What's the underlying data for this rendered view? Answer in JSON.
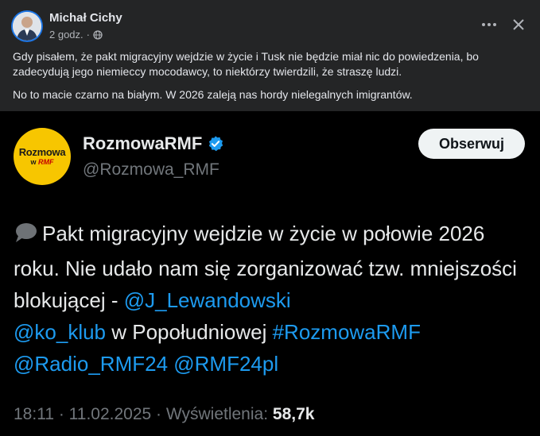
{
  "post": {
    "author": "Michał Cichy",
    "time": "2 godz.",
    "audience_icon": "globe-icon",
    "paragraph1": "Gdy pisałem, że pakt migracyjny wejdzie w życie i Tusk nie będzie miał nic do powiedzenia, bo zadecydują jego niemieccy mocodawcy, to niektórzy twierdzili, że straszę ludzi.",
    "paragraph2": "No to macie czarno na białym. W 2026 zaleją nas hordy nielegalnych imigrantów."
  },
  "tweet": {
    "avatar_line1": "Rozmowa",
    "avatar_line2a": "w",
    "avatar_line2b": "RMF",
    "display_name": "RozmowaRMF",
    "handle": "@Rozmowa_RMF",
    "follow_label": "Obserwuj",
    "text_part1": "Pakt migracyjny wejdzie w życie w połowie 2026 roku. Nie udało nam się zorganizować tzw. mniejszości blokującej - ",
    "mention1": "@J_Lewandowski",
    "mention2": "@ko_klub",
    "text_part2": " w Popołudniowej ",
    "hashtag": "#RozmowaRMF",
    "mention3": "@Radio_RMF24",
    "mention4": "@RMF24pl",
    "timestamp": "18:11 · 11.02.2025 · Wyświetlenia: ",
    "views": "58,7k"
  },
  "colors": {
    "link": "#1d9bf0",
    "verified": "#1d9bf0",
    "avatar_ring": "#1b74e4",
    "rmf_yellow": "#f7c600"
  }
}
